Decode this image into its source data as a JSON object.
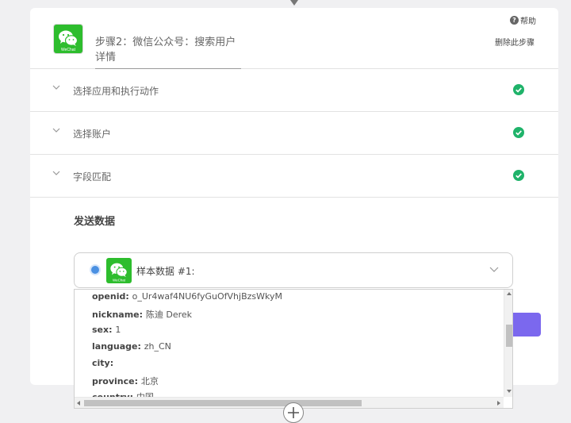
{
  "step": {
    "title": "步骤2：微信公众号：搜索用户详情",
    "help_label": "帮助",
    "delete_label": "删除此步骤",
    "app_icon": "wechat-icon",
    "app_icon_text": "WeChat"
  },
  "sections": [
    {
      "label": "选择应用和执行动作",
      "status": "complete"
    },
    {
      "label": "选择账户",
      "status": "complete"
    },
    {
      "label": "字段匹配",
      "status": "complete"
    }
  ],
  "send_data": {
    "title": "发送数据",
    "sample_select_label": "样本数据 #1:",
    "rows": [
      {
        "key": "openid",
        "value": "o_Ur4waf4NU6fyGuOfVhjBzsWkyM"
      },
      {
        "key": "nickname",
        "value": "陈迪 Derek"
      },
      {
        "key": "sex",
        "value": "1"
      },
      {
        "key": "language",
        "value": "zh_CN"
      },
      {
        "key": "city",
        "value": ""
      },
      {
        "key": "province",
        "value": "北京"
      },
      {
        "key": "country",
        "value": "中国"
      }
    ]
  },
  "colors": {
    "accent": "#7b68ee",
    "success": "#1fb36a",
    "wechat": "#2dbd2d",
    "radio": "#4a90e2"
  }
}
